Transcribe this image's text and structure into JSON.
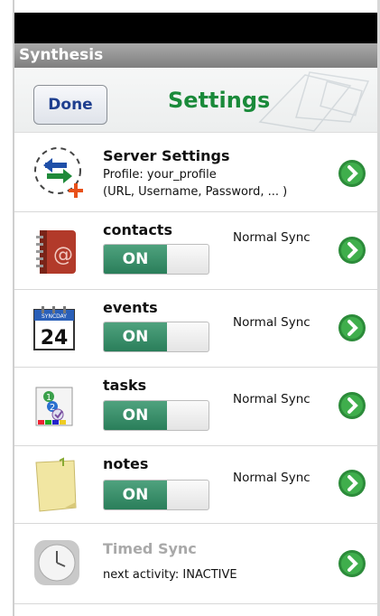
{
  "app_title": "Synthesis",
  "header": {
    "done_label": "Done",
    "title": "Settings"
  },
  "server": {
    "name": "Server Settings",
    "profile": "Profile: your_profile",
    "details": "(URL, Username, Password, ... )"
  },
  "items": [
    {
      "name": "contacts",
      "toggle": "ON",
      "mode": "Normal Sync"
    },
    {
      "name": "events",
      "toggle": "ON",
      "mode": "Normal Sync",
      "calendar_day": "24",
      "calendar_header": "SYNCDAY"
    },
    {
      "name": "tasks",
      "toggle": "ON",
      "mode": "Normal Sync"
    },
    {
      "name": "notes",
      "toggle": "ON",
      "mode": "Normal Sync"
    }
  ],
  "timed": {
    "name": "Timed Sync",
    "status": "next activity:  INACTIVE"
  },
  "colors": {
    "accent_green": "#1a8a3a",
    "toggle_green": "#2a7e5a",
    "done_text": "#1f3f8f"
  }
}
